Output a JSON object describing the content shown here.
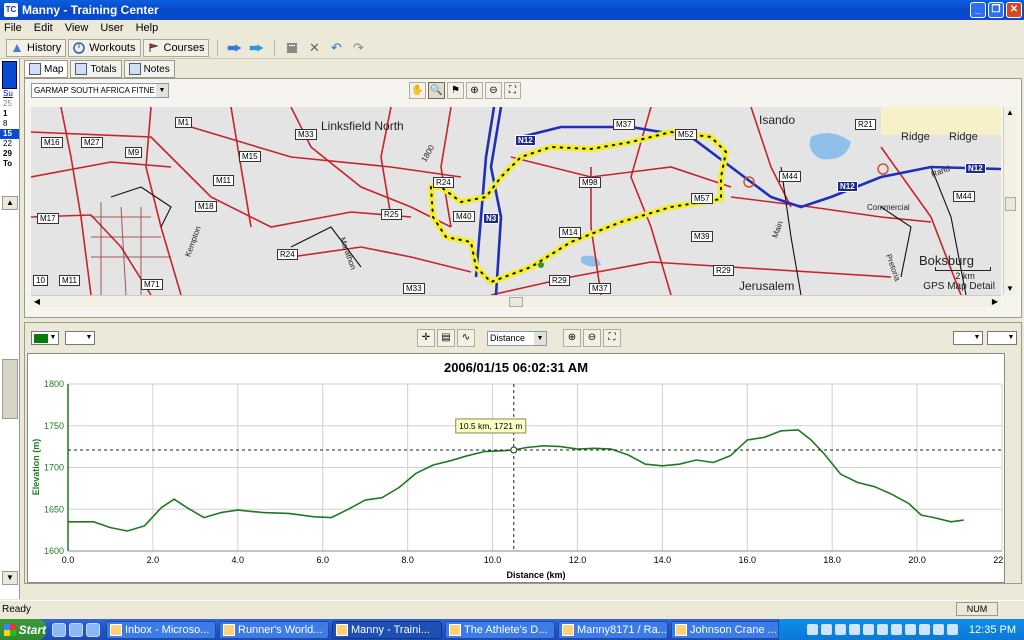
{
  "window": {
    "title": "Manny - Training Center",
    "app_icon": "TC"
  },
  "menu": [
    "File",
    "Edit",
    "View",
    "User",
    "Help"
  ],
  "toolbar": {
    "history": "History",
    "workouts": "Workouts",
    "courses": "Courses"
  },
  "left_panel": {
    "lines": [
      "Su",
      "25",
      "1",
      "8",
      "15",
      "22",
      "29",
      "To"
    ]
  },
  "map_tabs": [
    "Map",
    "Totals",
    "Notes"
  ],
  "map": {
    "source_select": "GARMAP SOUTH AFRICA FITNE",
    "place_labels": [
      "Linksfield North",
      "Isando",
      "Ridge",
      "Ridge",
      "Boksburg",
      "Jerusalem",
      "Commercial",
      "Main",
      "Marathon",
      "Pretoria",
      "1800",
      "Rand",
      "Kempton"
    ],
    "road_shields": [
      "M1",
      "M16",
      "M27",
      "M9",
      "M15",
      "M11",
      "M18",
      "M17",
      "M33",
      "M37",
      "M52",
      "M98",
      "M14",
      "M57",
      "M39",
      "M44",
      "M11",
      "M71",
      "M33",
      "R24",
      "R25",
      "R24",
      "R29",
      "R21",
      "R29",
      "M37",
      "M40",
      "M44",
      "10"
    ],
    "national_shields": [
      "N12",
      "N3",
      "N12",
      "N12"
    ],
    "scale_label": "2 km",
    "detail_label": "GPS Map Detail"
  },
  "chart_controls": {
    "x_axis_select": "Distance"
  },
  "chart_data": {
    "type": "line",
    "title": "2006/01/15 06:02:31 AM",
    "xlabel": "Distance (km)",
    "ylabel": "Elevation (m)",
    "xlim": [
      0,
      22
    ],
    "ylim": [
      1600,
      1800
    ],
    "x_ticks": [
      "0.0",
      "2.0",
      "4.0",
      "6.0",
      "8.0",
      "10.0",
      "12.0",
      "14.0",
      "16.0",
      "18.0",
      "20.0",
      "22.0"
    ],
    "y_ticks": [
      "1600",
      "1650",
      "1700",
      "1750",
      "1800"
    ],
    "grid": true,
    "line_color": "#1f7a1f",
    "series": [
      {
        "x": [
          0,
          0.6,
          1.0,
          1.4,
          1.8,
          2.2,
          2.5,
          2.8,
          3.2,
          3.6,
          4.0,
          4.6,
          5.2,
          5.8,
          6.2,
          6.6,
          7.0,
          7.4,
          7.8,
          8.2,
          8.6,
          9.0,
          9.4,
          9.8,
          10.2,
          10.5,
          10.8,
          11.2,
          11.6,
          12.0,
          12.4,
          12.8,
          13.2,
          13.6,
          14.0,
          14.4,
          14.8,
          15.2,
          15.6,
          16.0,
          16.4,
          16.8,
          17.2,
          17.5,
          17.8,
          18.2,
          18.6,
          19.0,
          19.4,
          19.8,
          20.1,
          20.4,
          20.8,
          21.1
        ],
        "y": [
          1635,
          1635,
          1628,
          1624,
          1630,
          1652,
          1662,
          1652,
          1640,
          1646,
          1649,
          1646,
          1645,
          1641,
          1640,
          1650,
          1661,
          1664,
          1676,
          1693,
          1703,
          1708,
          1714,
          1719,
          1720,
          1721,
          1724,
          1726,
          1725,
          1722,
          1723,
          1722,
          1715,
          1704,
          1702,
          1704,
          1709,
          1706,
          1714,
          1733,
          1736,
          1744,
          1745,
          1733,
          1717,
          1692,
          1682,
          1677,
          1668,
          1657,
          1643,
          1640,
          1635,
          1637
        ]
      }
    ],
    "crosshair": {
      "x": 10.5,
      "y": 1721,
      "label": "10.5 km, 1721 m"
    }
  },
  "status": {
    "text": "Ready",
    "num": "NUM"
  },
  "taskbar": {
    "start": "Start",
    "tasks": [
      "Inbox - Microso...",
      "Runner's World...",
      "Manny - Traini...",
      "The Athlete's D...",
      "Manny8171 / Ra...",
      "Johnson Crane ..."
    ],
    "clock": "12:35 PM"
  }
}
